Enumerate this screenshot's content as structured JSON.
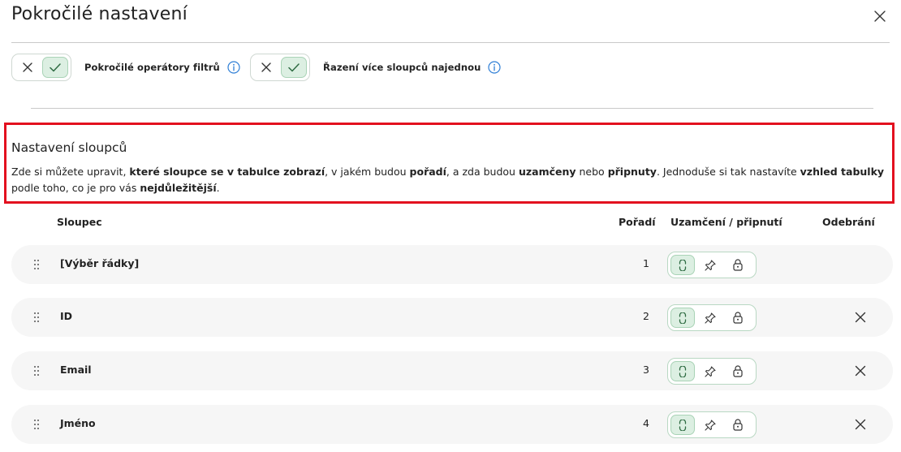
{
  "dialog": {
    "title": "Pokročilé nastavení",
    "close_icon": "close-icon"
  },
  "toggles": [
    {
      "label": "Pokročilé operátory filtrů",
      "state": "on"
    },
    {
      "label": "Řazení více sloupců najednou",
      "state": "on"
    }
  ],
  "section": {
    "title": "Nastavení sloupců",
    "desc": {
      "p1": "Zde si můžete upravit, ",
      "b1": "které sloupce se v tabulce zobrazí",
      "p2": ", v jakém budou ",
      "b2": "pořadí",
      "p3": ", a zda budou ",
      "b3": "uzamčeny",
      "p4": " nebo ",
      "b4": "připnuty",
      "p5": ". Jednoduše si tak nastavíte ",
      "b5": "vzhled tabulky",
      "p6": " podle toho, co je pro vás ",
      "b6": "nejdůležitější",
      "p7": "."
    }
  },
  "table": {
    "headers": {
      "column": "Sloupec",
      "order": "Pořadí",
      "lock": "Uzamčení / připnutí",
      "remove": "Odebrání"
    },
    "rows": [
      {
        "name": "[Výběr řádky]",
        "order": "1",
        "lock_state": "unlocked",
        "removable": false
      },
      {
        "name": "ID",
        "order": "2",
        "lock_state": "unlocked",
        "removable": true
      },
      {
        "name": "Email",
        "order": "3",
        "lock_state": "unlocked",
        "removable": true
      },
      {
        "name": "Jméno",
        "order": "4",
        "lock_state": "unlocked",
        "removable": true
      }
    ]
  },
  "colors": {
    "accent_green": "#dcefe2",
    "accent_green_border": "#a9d3b6",
    "info_blue": "#2f7fd6",
    "highlight_red": "#e3101f"
  }
}
